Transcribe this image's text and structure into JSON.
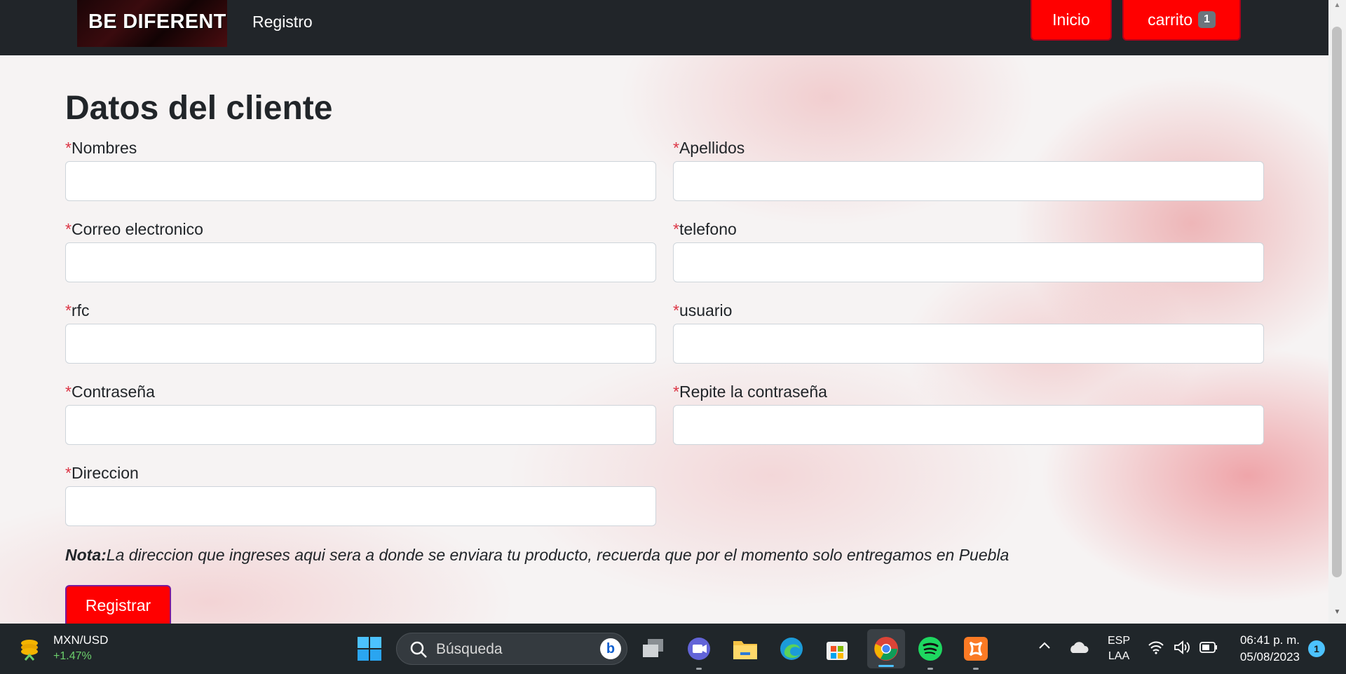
{
  "navbar": {
    "brand": "BE DIFERENT",
    "registro_label": "Registro",
    "inicio_label": "Inicio",
    "carrito_label": "carrito",
    "cart_count": "1"
  },
  "form": {
    "title": "Datos del cliente",
    "required_mark": "*",
    "fields": [
      {
        "label": "Nombres",
        "value": ""
      },
      {
        "label": "Apellidos",
        "value": ""
      },
      {
        "label": "Correo electronico",
        "value": ""
      },
      {
        "label": "telefono",
        "value": ""
      },
      {
        "label": "rfc",
        "value": ""
      },
      {
        "label": "usuario",
        "value": ""
      },
      {
        "label": "Contraseña",
        "value": ""
      },
      {
        "label": "Repite la contraseña",
        "value": ""
      },
      {
        "label": "Direccion",
        "value": ""
      }
    ],
    "note_label": "Nota:",
    "note_text": "La direccion que ingreses aqui sera a donde se enviara tu producto, recuerda que por el momento solo entregamos en Puebla",
    "submit_label": "Registrar"
  },
  "colors": {
    "accent_red": "#ff0000",
    "navbar_bg": "#212529",
    "required_red": "#dc3545",
    "taskbar_bg": "#20262a"
  },
  "taskbar": {
    "widget": {
      "title": "MXN/USD",
      "change": "+1.47%",
      "icon": "coins-icon"
    },
    "search_placeholder": "Búsqueda",
    "apps": [
      "start-icon",
      "task-view-icon",
      "teams-icon",
      "file-explorer-icon",
      "edge-icon",
      "store-icon",
      "chrome-icon",
      "spotify-icon",
      "xampp-icon"
    ],
    "language": {
      "line1": "ESP",
      "line2": "LAA"
    },
    "time": "06:41 p. m.",
    "date": "05/08/2023",
    "notification_count": "1"
  }
}
